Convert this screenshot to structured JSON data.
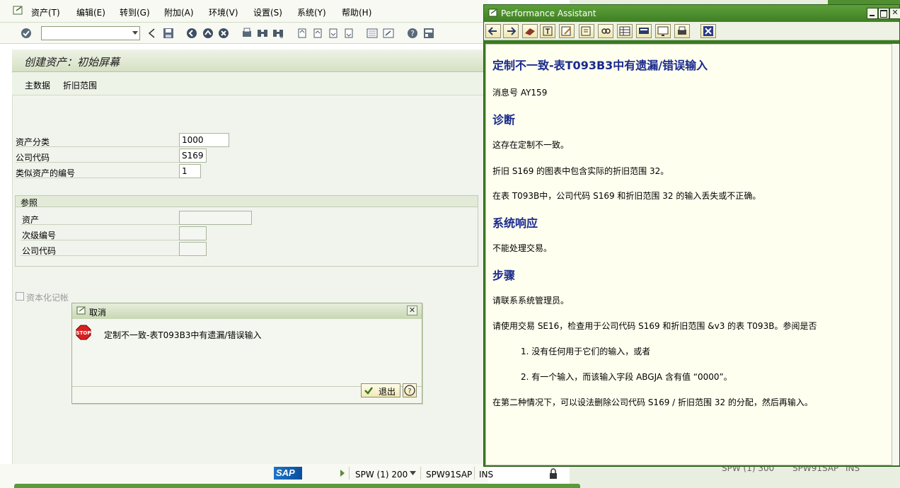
{
  "menu": {
    "items": [
      "资产(T)",
      "编辑(E)",
      "转到(G)",
      "附加(A)",
      "环境(V)",
      "设置(S)",
      "系统(Y)",
      "帮助(H)"
    ]
  },
  "screen": {
    "title": "创建资产：初始屏幕",
    "buttons": {
      "master_data": "主数据",
      "depreciation_area": "折旧范围"
    }
  },
  "form": {
    "asset_class_label": "资产分类",
    "asset_class_value": "1000",
    "company_code_label": "公司代码",
    "company_code_value": "S169",
    "similar_assets_label": "类似资产的编号",
    "similar_assets_value": "1",
    "reference": {
      "group_title": "参照",
      "asset_label": "资产",
      "asset_value": "",
      "subnumber_label": "次级编号",
      "subnumber_value": "",
      "company_code_label": "公司代码",
      "company_code_value": ""
    },
    "capitalized_label": "资本化记帐"
  },
  "dialog": {
    "title": "取消",
    "icon": "stop-icon",
    "message": "定制不一致-表T093B3中有遗漏/错误输入",
    "exit_label": "退出"
  },
  "status": {
    "logo": "SAP",
    "session": "SPW (1) 200",
    "server": "SPW91SAP",
    "mode": "INS",
    "bg_session": "SPW (1) 300",
    "bg_server": "SPW91SAP",
    "bg_mode": "INS"
  },
  "pa": {
    "title": "Performance Assistant",
    "heading": "定制不一致-表T093B3中有遗漏/错误输入",
    "message_no": "消息号  AY159",
    "diag_title": "诊断",
    "diag_1": "这存在定制不一致。",
    "diag_2": "折旧  S169 的图表中包含实际的折旧范围  32。",
    "diag_3": "在表  T093B中，公司代码  S169 和折旧范围  32 的输入丢失或不正确。",
    "resp_title": "系统响应",
    "resp_1": "不能处理交易。",
    "steps_title": "步骤",
    "steps_1": "请联系系统管理员。",
    "steps_2": "请使用交易  SE16，检查用于公司代码  S169 和折旧范围  &v3 的表  T093B。参阅是否",
    "list_1": "1. 没有任何用于它们的输入，或者",
    "list_2": "2. 有一个输入，而该输入字段  ABGJA 含有值 “0000”。",
    "steps_3": "在第二种情况下，可以设法删除公司代码  S169 / 折旧范围  32 的分配，然后再输入。"
  },
  "colors": {
    "pa_frame": "#3a7b22",
    "heading_blue": "#1a2a8c",
    "title_band": "#d5e0c4"
  }
}
